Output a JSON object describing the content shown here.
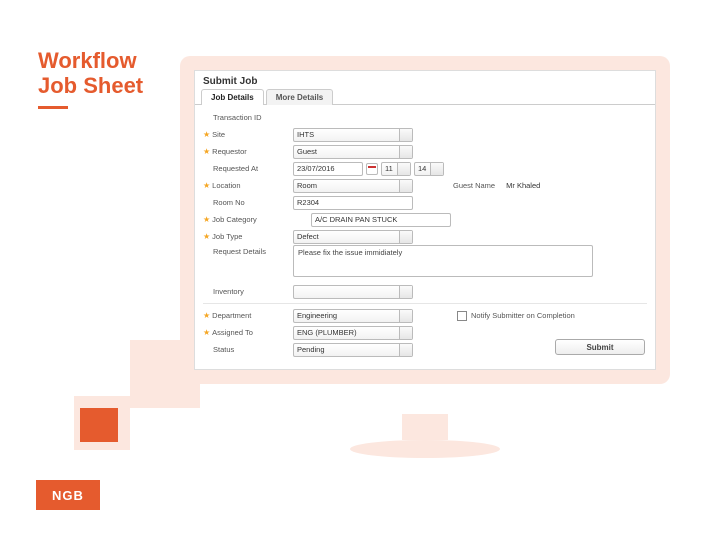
{
  "page": {
    "title_line1": "Workflow",
    "title_line2": "Job Sheet"
  },
  "window": {
    "title": "Submit Job",
    "tabs": [
      "Job Details",
      "More Details"
    ],
    "active_tab": 0
  },
  "form": {
    "transaction_id": {
      "label": "Transaction ID",
      "value": ""
    },
    "site": {
      "label": "Site",
      "value": "IHTS"
    },
    "requestor": {
      "label": "Requestor",
      "value": "Guest"
    },
    "requested_at": {
      "label": "Requested At",
      "date": "23/07/2016",
      "hour": "11",
      "minute": "14"
    },
    "location": {
      "label": "Location",
      "value": "Room"
    },
    "guest_name": {
      "label": "Guest Name",
      "value": "Mr Khaled"
    },
    "room_no": {
      "label": "Room No",
      "value": "R2304"
    },
    "job_category": {
      "label": "Job Category",
      "value": "A/C DRAIN PAN STUCK"
    },
    "job_type": {
      "label": "Job Type",
      "value": "Defect"
    },
    "request_details": {
      "label": "Request Details",
      "value": "Please fix the issue immidiately"
    },
    "inventory": {
      "label": "Inventory",
      "value": ""
    },
    "department": {
      "label": "Department",
      "value": "Engineering"
    },
    "notify": {
      "label": "Notify Submitter on Completion",
      "checked": false
    },
    "assigned_to": {
      "label": "Assigned To",
      "value": "ENG (PLUMBER)"
    },
    "status": {
      "label": "Status",
      "value": "Pending"
    },
    "submit_label": "Submit"
  },
  "footer": {
    "logo_text": "NGB"
  }
}
